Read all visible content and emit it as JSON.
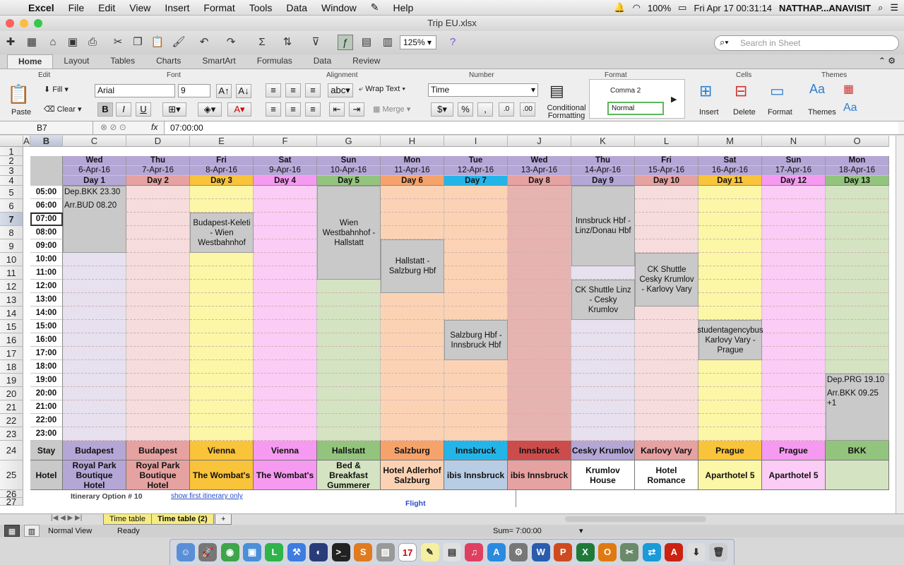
{
  "menubar": {
    "app": "Excel",
    "items": [
      "File",
      "Edit",
      "View",
      "Insert",
      "Format",
      "Tools",
      "Data",
      "Window",
      "Help"
    ],
    "battery": "100%",
    "datetime": "Fri Apr 17  00:31:14",
    "user": "NATTHAP...ANAVISIT"
  },
  "window": {
    "title": "Trip EU.xlsx"
  },
  "toolbar": {
    "zoom": "125%",
    "search_placeholder": "Search in Sheet"
  },
  "ribbon": {
    "tabs": [
      "Home",
      "Layout",
      "Tables",
      "Charts",
      "SmartArt",
      "Formulas",
      "Data",
      "Review"
    ],
    "groups": {
      "edit": "Edit",
      "font": "Font",
      "alignment": "Alignment",
      "number": "Number",
      "format": "Format",
      "cells": "Cells",
      "themes": "Themes"
    },
    "paste": "Paste",
    "fill": "Fill",
    "clear": "Clear",
    "font_name": "Arial",
    "font_size": "9",
    "wrap_text": "Wrap Text",
    "merge": "Merge",
    "number_format": "Time",
    "conditional_formatting": "Conditional Formatting",
    "style1": "Comma 2",
    "style2": "Normal",
    "insert": "Insert",
    "delete": "Delete",
    "format": "Format",
    "themes": "Themes"
  },
  "formula_bar": {
    "cell_ref": "B7",
    "fx": "fx",
    "value": "07:00:00"
  },
  "columns": [
    "A",
    "B",
    "C",
    "D",
    "E",
    "F",
    "G",
    "H",
    "I",
    "J",
    "K",
    "L",
    "M",
    "N",
    "O"
  ],
  "rows": [
    "1",
    "2",
    "3",
    "4",
    "5",
    "6",
    "7",
    "8",
    "9",
    "10",
    "11",
    "12",
    "13",
    "14",
    "15",
    "16",
    "17",
    "18",
    "19",
    "20",
    "21",
    "22",
    "23",
    "24",
    "25",
    "26",
    "27"
  ],
  "days": [
    {
      "dow": "Wed",
      "date": "6-Apr-16",
      "day": "Day 1",
      "color": "#e6e0ef",
      "head": "#b4a7d6",
      "daycol": "#b4a7d6"
    },
    {
      "dow": "Thu",
      "date": "7-Apr-16",
      "day": "Day 2",
      "color": "#f6dcdc",
      "head": "#b4a7d6",
      "daycol": "#e6a1a1"
    },
    {
      "dow": "Fri",
      "date": "8-Apr-16",
      "day": "Day 3",
      "color": "#fbf7a6",
      "head": "#b4a7d6",
      "daycol": "#f9c33a"
    },
    {
      "dow": "Sat",
      "date": "9-Apr-16",
      "day": "Day 4",
      "color": "#fbccf5",
      "head": "#b4a7d6",
      "daycol": "#f59af0"
    },
    {
      "dow": "Sun",
      "date": "10-Apr-16",
      "day": "Day 5",
      "color": "#d4e3c2",
      "head": "#b4a7d6",
      "daycol": "#93c47d"
    },
    {
      "dow": "Mon",
      "date": "11-Apr-16",
      "day": "Day 6",
      "color": "#fbd3b4",
      "head": "#b4a7d6",
      "daycol": "#f6a36b"
    },
    {
      "dow": "Tue",
      "date": "12-Apr-16",
      "day": "Day 7",
      "color": "#fbd3b4",
      "head": "#b4a7d6",
      "daycol": "#24b5e8"
    },
    {
      "dow": "Wed",
      "date": "13-Apr-16",
      "day": "Day 8",
      "color": "#e7b3b1",
      "head": "#b4a7d6",
      "daycol": "#e6a1a1"
    },
    {
      "dow": "Thu",
      "date": "14-Apr-16",
      "day": "Day 9",
      "color": "#e6e0ef",
      "head": "#b4a7d6",
      "daycol": "#b4a7d6"
    },
    {
      "dow": "Fri",
      "date": "15-Apr-16",
      "day": "Day 10",
      "color": "#f6dcdc",
      "head": "#b4a7d6",
      "daycol": "#e6a1a1"
    },
    {
      "dow": "Sat",
      "date": "16-Apr-16",
      "day": "Day 11",
      "color": "#fbf7a6",
      "head": "#b4a7d6",
      "daycol": "#f9c33a"
    },
    {
      "dow": "Sun",
      "date": "17-Apr-16",
      "day": "Day 12",
      "color": "#fbccf5",
      "head": "#b4a7d6",
      "daycol": "#f59af0"
    },
    {
      "dow": "Mon",
      "date": "18-Apr-16",
      "day": "Day 13",
      "color": "#d4e3c2",
      "head": "#b4a7d6",
      "daycol": "#93c47d"
    }
  ],
  "times": [
    "05:00",
    "06:00",
    "07:00",
    "08:00",
    "09:00",
    "10:00",
    "11:00",
    "12:00",
    "13:00",
    "14:00",
    "15:00",
    "16:00",
    "17:00",
    "18:00",
    "19:00",
    "20:00",
    "21:00",
    "22:00",
    "23:00"
  ],
  "notes": {
    "dep_bkk": "Dep.BKK 23.30",
    "arr_bud": "Arr.BUD 08.20",
    "dep_prg": "Dep.PRG 19.10",
    "arr_bkk": "Arr.BKK 09.25 +1"
  },
  "blocks": {
    "b1": "Budapest-Keleti - Wien Westbahnhof",
    "b2": "Wien Westbahnhof - Hallstatt",
    "b3": "Hallstatt - Salzburg Hbf",
    "b4": "Salzburg Hbf - Innsbruck Hbf",
    "b5": "Innsbruck Hbf - Linz/Donau Hbf",
    "b6": "CK Shuttle   Linz - Cesky Krumlov",
    "b7": "CK Shuttle Cesky Krumlov - Karlovy Vary",
    "b8": "studentagencybus Karlovy Vary - Prague"
  },
  "stay": {
    "label": "Stay",
    "values": [
      "Budapest",
      "Budapest",
      "Vienna",
      "Vienna",
      "Hallstatt",
      "Salzburg",
      "Innsbruck",
      "Innsbruck",
      "Cesky Krumlov",
      "Karlovy Vary",
      "Prague",
      "Prague",
      "BKK"
    ],
    "colors": [
      "#b4a7d6",
      "#e6a1a1",
      "#f9c33a",
      "#f59af0",
      "#93c47d",
      "#f6a36b",
      "#24b5e8",
      "#cc4c4c",
      "#b4a7d6",
      "#e6a1a1",
      "#f9c33a",
      "#f59af0",
      "#93c47d"
    ]
  },
  "hotel": {
    "label": "Hotel",
    "values": [
      "Royal Park Boutique Hotel",
      "Royal Park Boutique Hotel",
      "The Wombat's",
      "The Wombat's",
      "Bed & Breakfast Gummerer",
      "Hotel Adlerhof Salzburg",
      "ibis Innsbruck",
      "ibis Innsbruck",
      "Krumlov House",
      "Hotel Romance",
      "Aparthotel 5",
      "Aparthotel 5",
      ""
    ],
    "colors": [
      "#b4a7d6",
      "#e6a1a1",
      "#f9c33a",
      "#f59af0",
      "#d4e3c2",
      "#fbd3b4",
      "#b8cde3",
      "#e6a1a1",
      "#ffffff",
      "#ffffff",
      "#fbf7a6",
      "#fbccf5",
      "#d4e3c2"
    ]
  },
  "footer": {
    "itinerary": "Itinerary Option # 10",
    "link": "show first itinerary only",
    "flight": "Flight"
  },
  "sheets": [
    "Time table",
    "Time table (2)"
  ],
  "status": {
    "view": "Normal View",
    "ready": "Ready",
    "sum": "Sum= 7:00:00"
  }
}
